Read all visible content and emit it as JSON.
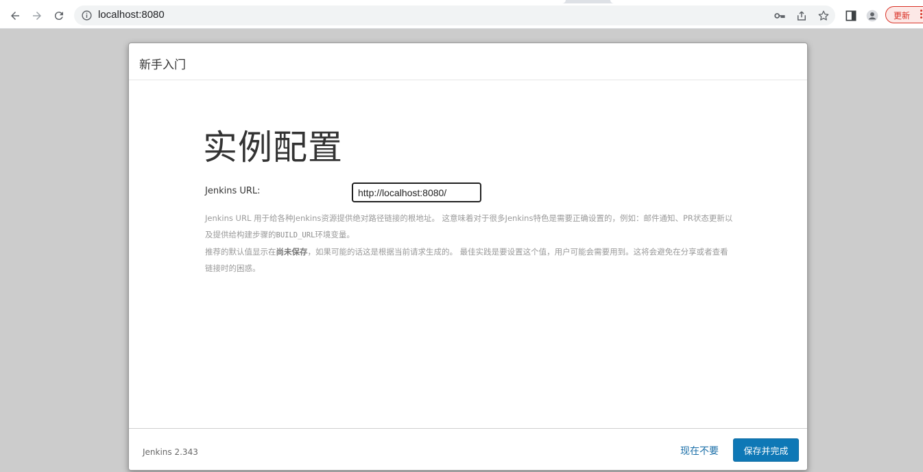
{
  "browser": {
    "url": "localhost:8080",
    "update_label": "更新"
  },
  "dialog": {
    "header_title": "新手入门",
    "heading": "实例配置",
    "field_label": "Jenkins URL:",
    "field_value": "http://localhost:8080/",
    "help": {
      "line1_a": "Jenkins URL 用于给各种Jenkins资源提供绝对路径链接的根地址。 这意味着对于很多Jenkins特色是需要正确设置的，例如：邮件通知、PR状态更新以及提供给构建步骤的",
      "line1_code": "BUILD_URL",
      "line1_b": "环境变量。",
      "line2_a": "推荐的默认值显示在",
      "line2_bold": "尚未保存",
      "line2_b": "，如果可能的话这是根据当前请求生成的。 最佳实践是要设置这个值，用户可能会需要用到。这将会避免在分享或者查看链接时的困惑。"
    },
    "footer": {
      "version": "Jenkins 2.343",
      "skip_label": "现在不要",
      "save_label": "保存并完成"
    }
  },
  "colors": {
    "accent": "#0e78b6",
    "link": "#1b6fa8",
    "backdrop": "#cccccc",
    "update_red": "#d93025"
  }
}
